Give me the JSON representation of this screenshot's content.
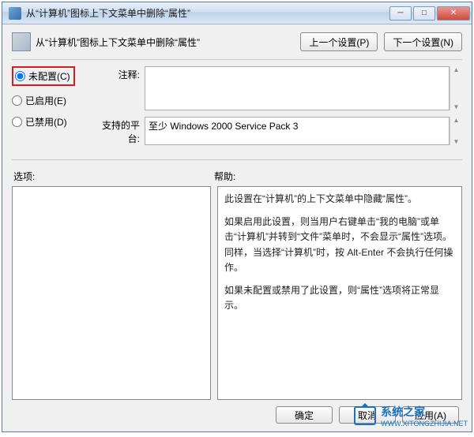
{
  "window": {
    "title": "从“计算机”图标上下文菜单中删除“属性”"
  },
  "header": {
    "policy_title": "从“计算机”图标上下文菜单中删除“属性”",
    "prev_button": "上一个设置(P)",
    "next_button": "下一个设置(N)"
  },
  "radios": {
    "not_configured": "未配置(C)",
    "enabled": "已启用(E)",
    "disabled": "已禁用(D)",
    "selected": "not_configured"
  },
  "fields": {
    "comment_label": "注释:",
    "comment_value": "",
    "platform_label": "支持的平台:",
    "platform_value": "至少 Windows 2000 Service Pack 3"
  },
  "lower": {
    "options_label": "选项:",
    "help_label": "帮助:",
    "help_text": [
      "此设置在“计算机”的上下文菜单中隐藏“属性”。",
      "如果启用此设置，则当用户右键单击“我的电脑”或单击“计算机”并转到“文件”菜单时，不会显示“属性”选项。同样，当选择“计算机”时，按 Alt-Enter 不会执行任何操作。",
      "如果未配置或禁用了此设置，则“属性”选项将正常显示。"
    ]
  },
  "footer": {
    "ok": "确定",
    "cancel": "取消",
    "apply": "应用(A)"
  },
  "watermark": {
    "brand": "系统之家",
    "url": "WWW.XITONGZHIJIA.NET"
  }
}
